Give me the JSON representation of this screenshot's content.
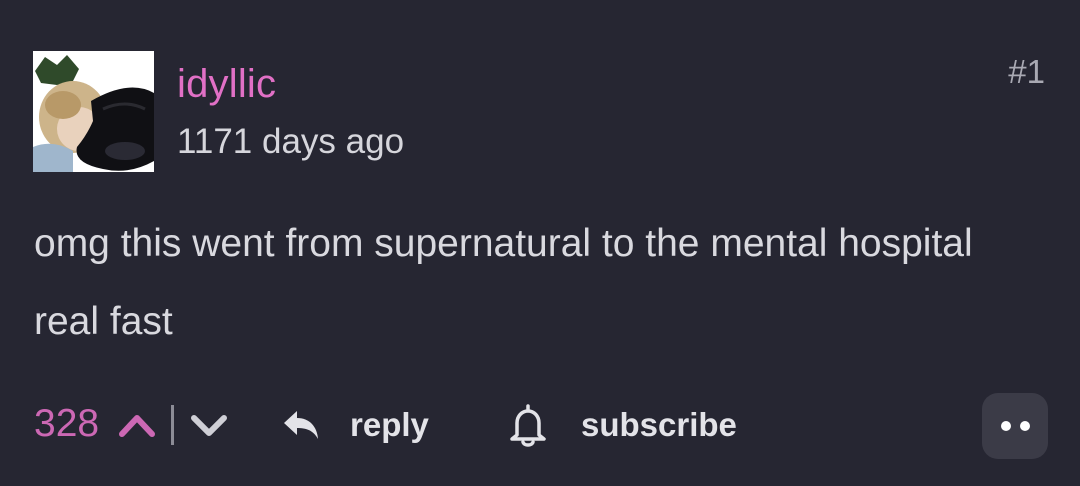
{
  "comment": {
    "username": "idyllic",
    "timestamp": "1171 days ago",
    "number": "#1",
    "body": "omg this went from supernatural to the mental hospital real fast"
  },
  "actions": {
    "score": "328",
    "reply_label": "reply",
    "subscribe_label": "subscribe"
  },
  "icons": {
    "upvote": "chevron-up-icon",
    "downvote": "chevron-down-icon",
    "reply": "reply-arrow-icon",
    "subscribe": "bell-icon",
    "more": "more-dots-icon"
  },
  "colors": {
    "background": "#262632",
    "username": "#e170c6",
    "score": "#cc68b4",
    "text": "#d9d9df",
    "more_button_bg": "#3b3b47"
  }
}
